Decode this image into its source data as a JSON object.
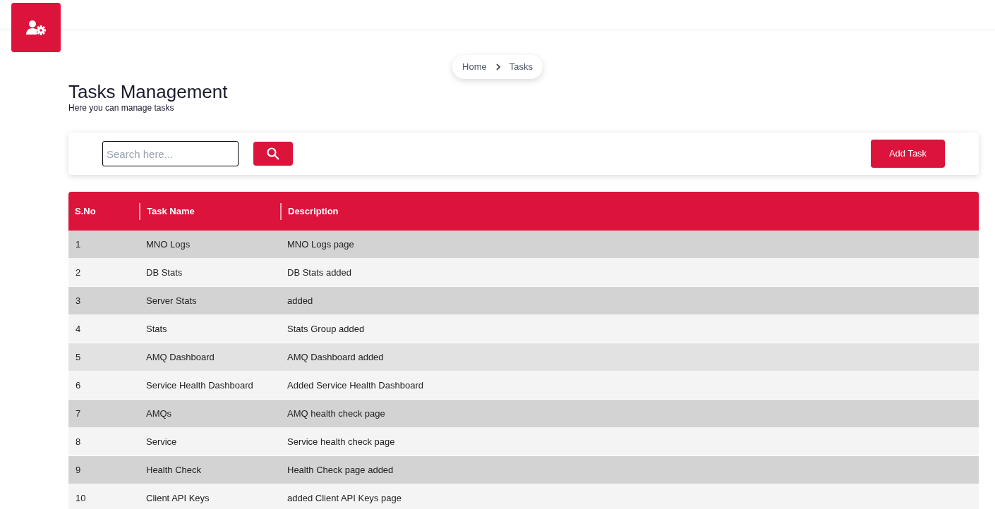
{
  "breadcrumb": [
    "Home",
    "Tasks"
  ],
  "page": {
    "title": "Tasks Management",
    "subtitle": "Here you can manage tasks"
  },
  "search": {
    "placeholder": "Search here..."
  },
  "add_button": "Add Task",
  "table": {
    "columns": [
      "S.No",
      "Task Name",
      "Description"
    ],
    "rows": [
      {
        "cells": [
          "1",
          "MNO Logs",
          "MNO Logs page"
        ],
        "hovered": false
      },
      {
        "cells": [
          "2",
          "DB Stats",
          "DB Stats added"
        ],
        "hovered": false
      },
      {
        "cells": [
          "3",
          "Server Stats",
          "added"
        ],
        "hovered": false
      },
      {
        "cells": [
          "4",
          "Stats",
          "Stats Group added"
        ],
        "hovered": false
      },
      {
        "cells": [
          "5",
          "AMQ Dashboard",
          "AMQ Dashboard added"
        ],
        "hovered": true
      },
      {
        "cells": [
          "6",
          "Service Health Dashboard",
          "Added Service Health Dashboard"
        ],
        "hovered": false
      },
      {
        "cells": [
          "7",
          "AMQs",
          "AMQ health check page"
        ],
        "hovered": false
      },
      {
        "cells": [
          "8",
          "Service",
          "Service health check page"
        ],
        "hovered": false
      },
      {
        "cells": [
          "9",
          "Health Check",
          "Health Check page added"
        ],
        "hovered": false
      },
      {
        "cells": [
          "10",
          "Client API Keys",
          "added Client API Keys page"
        ],
        "hovered": false
      }
    ]
  }
}
